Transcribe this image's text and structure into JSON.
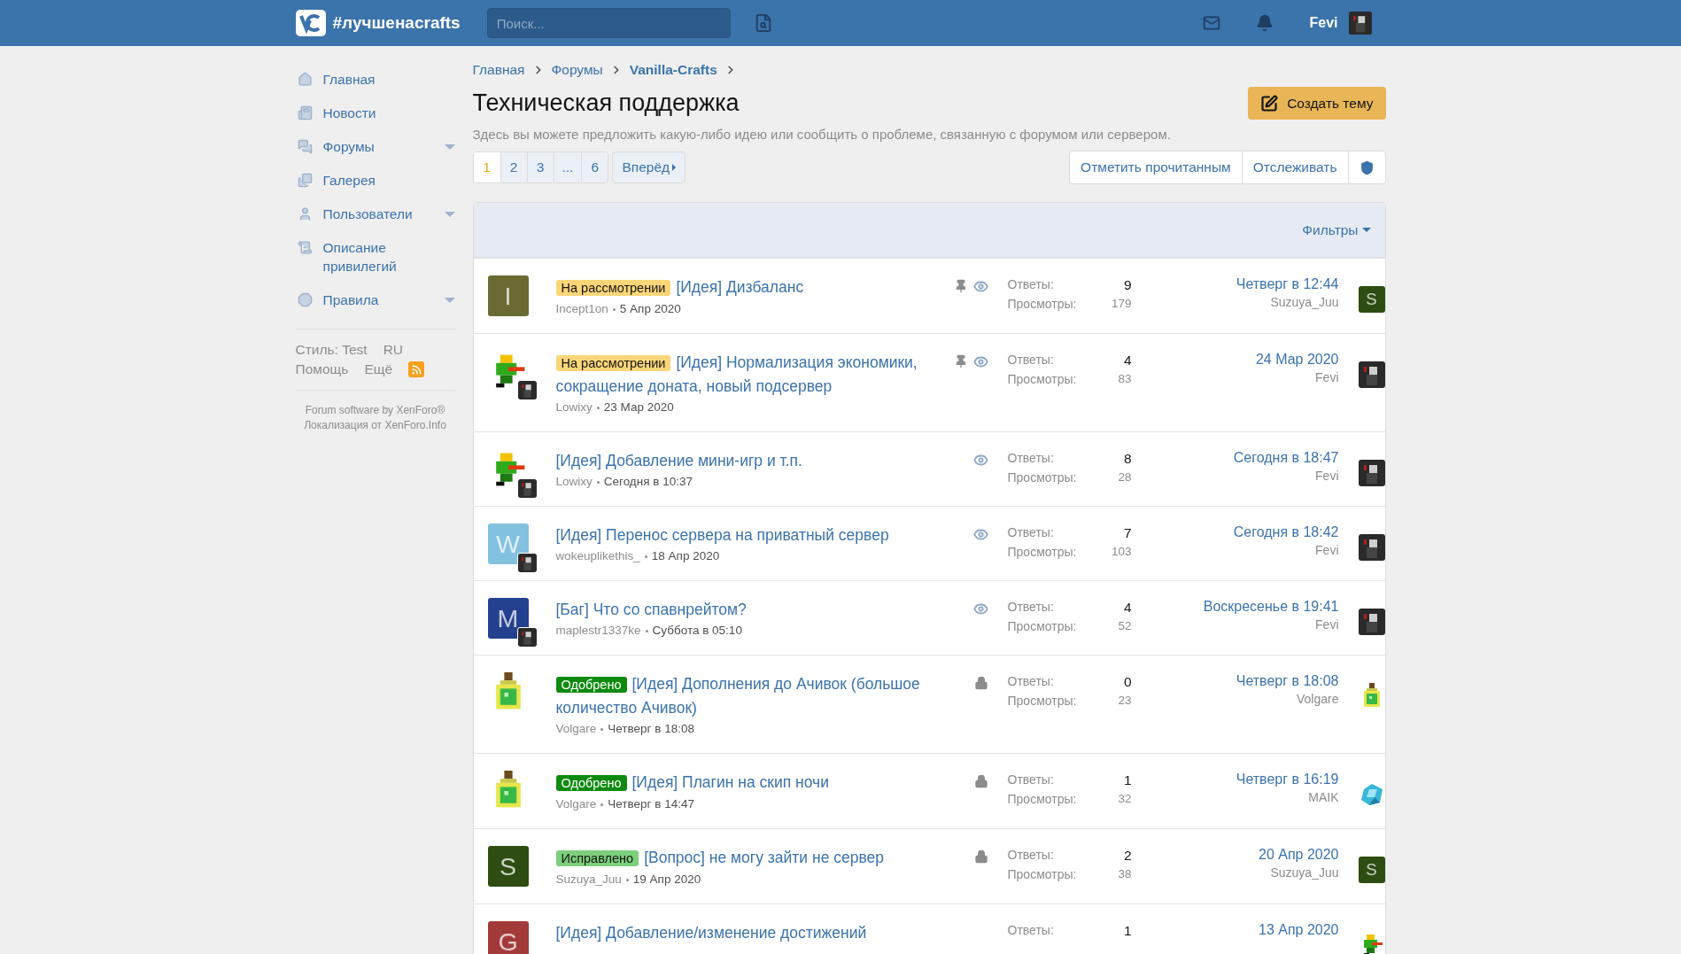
{
  "header": {
    "site_name": "#лучшенасrafts",
    "search": {
      "placeholder": "Поиск..."
    },
    "user": "Fevi"
  },
  "sidebar": {
    "items": [
      {
        "label": "Главная",
        "has_menu": false
      },
      {
        "label": "Новости",
        "has_menu": false
      },
      {
        "label": "Форумы",
        "has_menu": true
      },
      {
        "label": "Галерея",
        "has_menu": false
      },
      {
        "label": "Пользователи",
        "has_menu": true
      },
      {
        "label": "Описание привилегий",
        "has_menu": false
      },
      {
        "label": "Правила",
        "has_menu": true
      }
    ],
    "style_label": "Стиль: Test",
    "language": "RU",
    "help": "Помощь",
    "more": "Ещё",
    "footer": [
      "Forum software by XenForo®",
      "Локализация от XenForo.Info"
    ]
  },
  "breadcrumbs": [
    {
      "label": "Главная",
      "current": false
    },
    {
      "label": "Форумы",
      "current": false
    },
    {
      "label": "Vanilla-Crafts",
      "current": true
    }
  ],
  "title": "Техническая поддержка",
  "description": "Здесь вы можете предложить какую-либо идею или сообщить о проблеме, связанную с форумом или сервером.",
  "create_button": "Создать тему",
  "pages": [
    {
      "label": "1",
      "selected": true
    },
    {
      "label": "2",
      "selected": false
    },
    {
      "label": "3",
      "selected": false
    },
    {
      "label": "...",
      "selected": false
    },
    {
      "label": "6",
      "selected": false
    }
  ],
  "next_button": "Вперёд",
  "actions": [
    "Отметить прочитанным",
    "Отслеживать"
  ],
  "filters": "Фильтры",
  "threads": [
    {
      "avatar": {
        "kind": "letter",
        "letter": "I",
        "color": "#6b6a34"
      },
      "overlay": false,
      "prefix": {
        "label": "На рассмотрении",
        "color": "#fbd679"
      },
      "title": "[Идея] Дизбаланс",
      "author": "Incept1on",
      "date": "5 Апр 2020",
      "pinned": true,
      "watched": true,
      "locked": false,
      "replies_label": "Ответы:",
      "replies": "9",
      "views_label": "Просмотры:",
      "views": "179",
      "last_date": "Четверг в 12:44",
      "last_user": "Suzuya_Juu",
      "last_avatar": {
        "kind": "letter",
        "letter": "S",
        "color": "#2e4d12"
      }
    },
    {
      "avatar": {
        "kind": "parrot"
      },
      "overlay": true,
      "prefix": {
        "label": "На рассмотрении",
        "color": "#fbd679"
      },
      "title": "[Идея] Нормализация экономики, сокращение доната, новый подсервер",
      "author": "Lowixy",
      "date": "23 Мар 2020",
      "pinned": true,
      "watched": true,
      "locked": false,
      "replies_label": "Ответы:",
      "replies": "4",
      "views_label": "Просмотры:",
      "views": "83",
      "last_date": "24 Мар 2020",
      "last_user": "Fevi",
      "last_avatar": {
        "kind": "dark"
      }
    },
    {
      "avatar": {
        "kind": "parrot"
      },
      "overlay": true,
      "title": "[Идея] Добавление мини-игр и т.п.",
      "author": "Lowixy",
      "date": "Сегодня в 10:37",
      "pinned": false,
      "watched": true,
      "locked": false,
      "replies_label": "Ответы:",
      "replies": "8",
      "views_label": "Просмотры:",
      "views": "28",
      "last_date": "Сегодня в 18:47",
      "last_user": "Fevi",
      "last_avatar": {
        "kind": "dark"
      }
    },
    {
      "avatar": {
        "kind": "letter",
        "letter": "W",
        "color": "#82c1e0"
      },
      "overlay": true,
      "title": "[Идея] Перенос сервера на приватный сервер",
      "author": "wokeuplikethis_",
      "date": "18 Апр 2020",
      "pinned": false,
      "watched": true,
      "locked": false,
      "replies_label": "Ответы:",
      "replies": "7",
      "views_label": "Просмотры:",
      "views": "103",
      "last_date": "Сегодня в 18:42",
      "last_user": "Fevi",
      "last_avatar": {
        "kind": "dark"
      }
    },
    {
      "avatar": {
        "kind": "letter",
        "letter": "M",
        "color": "#24418f"
      },
      "overlay": true,
      "title": "[Баг] Что со спавнрейтом?",
      "author": "maplestr1337ke",
      "date": "Суббота в 05:10",
      "pinned": false,
      "watched": true,
      "locked": false,
      "replies_label": "Ответы:",
      "replies": "4",
      "views_label": "Просмотры:",
      "views": "52",
      "last_date": "Воскресенье в 19:41",
      "last_user": "Fevi",
      "last_avatar": {
        "kind": "dark"
      }
    },
    {
      "avatar": {
        "kind": "potion"
      },
      "overlay": false,
      "prefix": {
        "label": "Одобрено",
        "color": "#0f8a0f"
      },
      "title": "[Идея] Дополнения до Ачивок (большое количество Ачивок)",
      "author": "Volgare",
      "date": "Четверг в 18:08",
      "pinned": false,
      "watched": false,
      "locked": true,
      "replies_label": "Ответы:",
      "replies": "0",
      "views_label": "Просмотры:",
      "views": "23",
      "last_date": "Четверг в 18:08",
      "last_user": "Volgare",
      "last_avatar": {
        "kind": "potion"
      }
    },
    {
      "avatar": {
        "kind": "potion"
      },
      "overlay": false,
      "prefix": {
        "label": "Одобрено",
        "color": "#0f8a0f"
      },
      "title": "[Идея] Плагин на скип ночи",
      "author": "Volgare",
      "date": "Четверг в 14:47",
      "pinned": false,
      "watched": false,
      "locked": true,
      "replies_label": "Ответы:",
      "replies": "1",
      "views_label": "Просмотры:",
      "views": "32",
      "last_date": "Четверг в 16:19",
      "last_user": "MAIK",
      "last_avatar": {
        "kind": "crystal"
      }
    },
    {
      "avatar": {
        "kind": "letter",
        "letter": "S",
        "color": "#2e4d12"
      },
      "overlay": false,
      "prefix": {
        "label": "Исправлено",
        "color": "#7ccf7c"
      },
      "title": "[Вопрос] не могу зайти не сервер",
      "author": "Suzuya_Juu",
      "date": "19 Апр 2020",
      "pinned": false,
      "watched": false,
      "locked": true,
      "replies_label": "Ответы:",
      "replies": "2",
      "views_label": "Просмотры:",
      "views": "38",
      "last_date": "20 Апр 2020",
      "last_user": "Suzuya_Juu",
      "last_avatar": {
        "kind": "letter",
        "letter": "S",
        "color": "#2e4d12"
      }
    },
    {
      "avatar": {
        "kind": "letter",
        "letter": "G",
        "color": "#a33a3a"
      },
      "overlay": false,
      "title": "[Идея] Добавление/изменение достижений",
      "pinned": false,
      "watched": false,
      "locked": false,
      "replies_label": "Ответы:",
      "replies": "1",
      "last_date": "13 Апр 2020",
      "last_avatar": {
        "kind": "parrot"
      }
    }
  ]
}
